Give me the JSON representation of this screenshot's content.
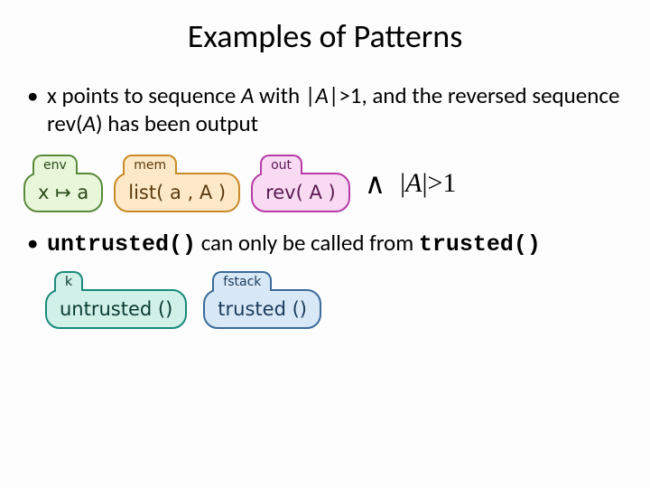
{
  "title": "Examples of Patterns",
  "bullet1": {
    "pre": "x points to sequence ",
    "A1": "A",
    "mid1": " with |",
    "A2": "A",
    "mid2": "|>1, and the reversed sequence rev(",
    "A3": "A",
    "post": ") has been output"
  },
  "blocks": {
    "env": {
      "tab": "env",
      "body": "x ↦ a"
    },
    "mem": {
      "tab": "mem",
      "body": "list( a , A )"
    },
    "out": {
      "tab": "out",
      "body": "rev( A )"
    },
    "k": {
      "tab": "k",
      "body": "untrusted ()"
    },
    "fstack": {
      "tab": "fstack",
      "body": "trusted ()"
    }
  },
  "conj": "∧",
  "cond": {
    "bar1": "|",
    "A": "A",
    "bar2": "|>1"
  },
  "bullet2": {
    "code1": "untrusted()",
    "mid": "can only be called from ",
    "code2": "trusted()"
  }
}
